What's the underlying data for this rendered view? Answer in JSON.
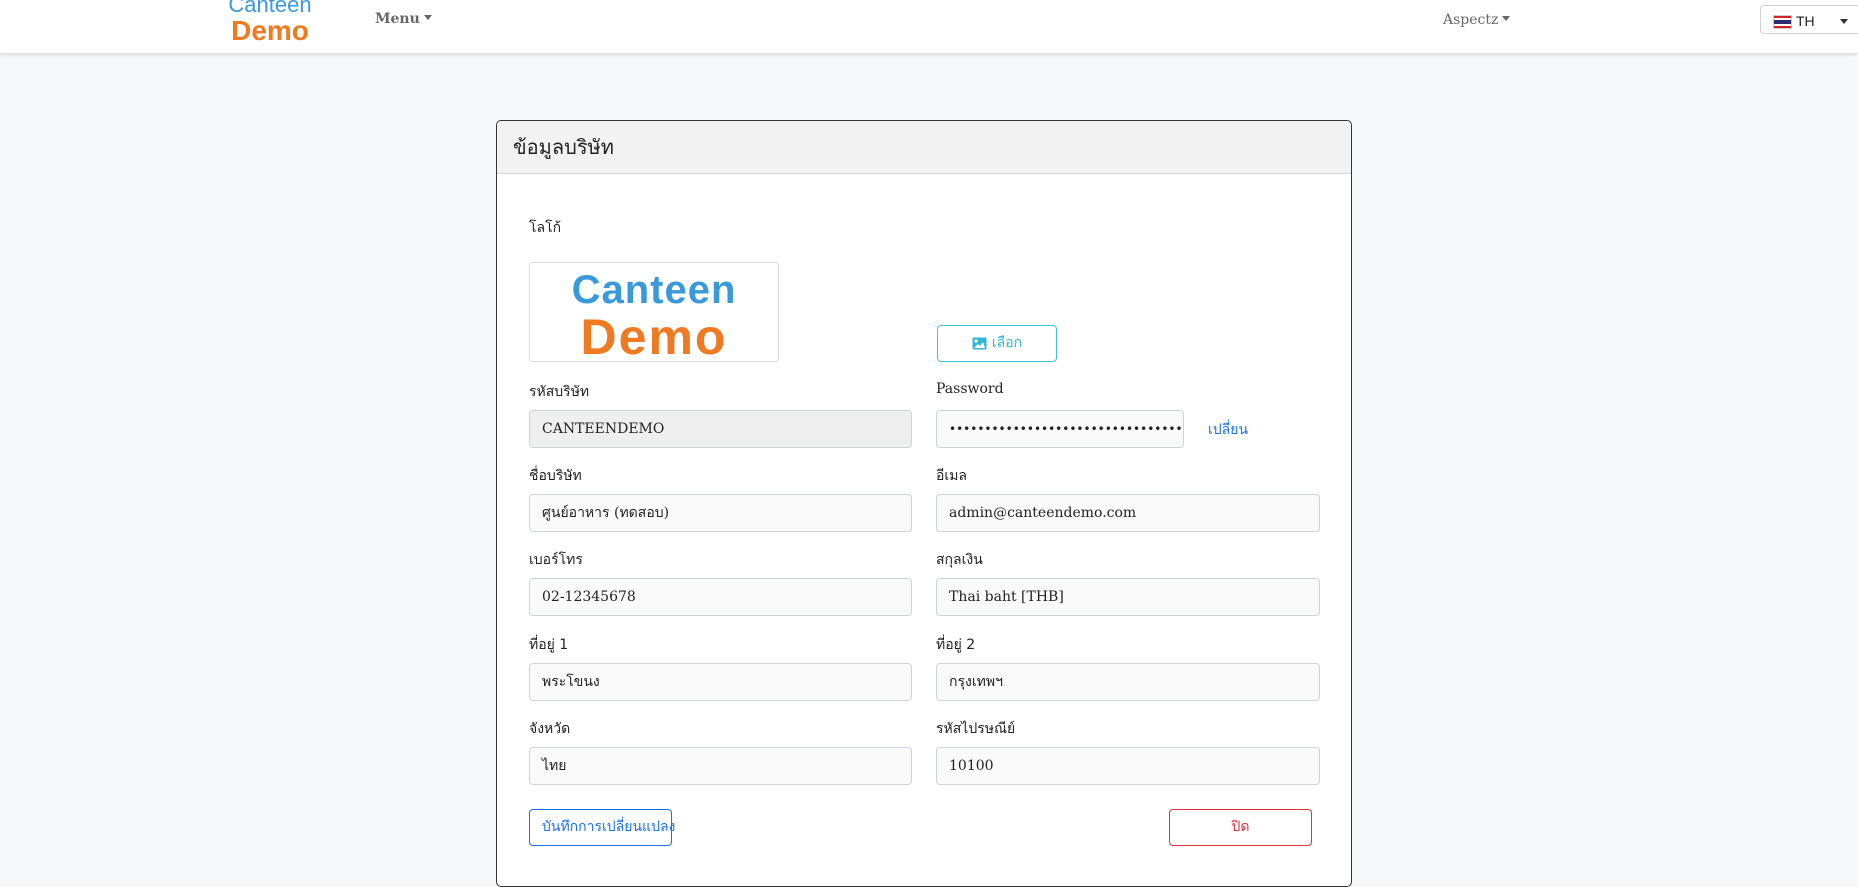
{
  "navbar": {
    "brand_line1": "Canteen",
    "brand_line2": "Demo",
    "menu_label": "Menu",
    "user_label": "Aspectz",
    "language": {
      "code": "TH",
      "flag_icon": "thailand-flag-icon"
    }
  },
  "card": {
    "title": "ข้อมูลบริษัท",
    "logo": {
      "label": "โลโก้",
      "image_line1": "Canteen",
      "image_line2": "Demo",
      "choose_button": "เลือก",
      "choose_icon": "image-icon"
    },
    "fields": {
      "company_code": {
        "label": "รหัสบริษัท",
        "value": "CANTEENDEMO"
      },
      "password": {
        "label": "Password",
        "value": "•••••••••••••••••••••••••••••••••••••••••••••",
        "change_link": "เปลี่ยน"
      },
      "company_name": {
        "label": "ชื่อบริษัท",
        "value": "ศูนย์อาหาร (ทดสอบ)"
      },
      "email": {
        "label": "อีเมล",
        "value": "admin@canteendemo.com"
      },
      "phone": {
        "label": "เบอร์โทร",
        "value": "02-12345678"
      },
      "currency": {
        "label": "สกุลเงิน",
        "value": "Thai baht [THB]"
      },
      "address1": {
        "label": "ที่อยู่ 1",
        "value": "พระโขนง"
      },
      "address2": {
        "label": "ที่อยู่ 2",
        "value": "กรุงเทพฯ"
      },
      "province": {
        "label": "จังหวัด",
        "value": "ไทย"
      },
      "postal_code": {
        "label": "รหัสไปรษณีย์",
        "value": "10100"
      }
    },
    "save_button": "บันทึกการเปลี่ยนแปลง",
    "close_button": "ปิด"
  },
  "colors": {
    "brand_blue": "#3a9ad9",
    "brand_orange": "#ef7a22",
    "primary": "#1a73e8",
    "info": "#2fb6d8",
    "danger": "#dc3545"
  }
}
